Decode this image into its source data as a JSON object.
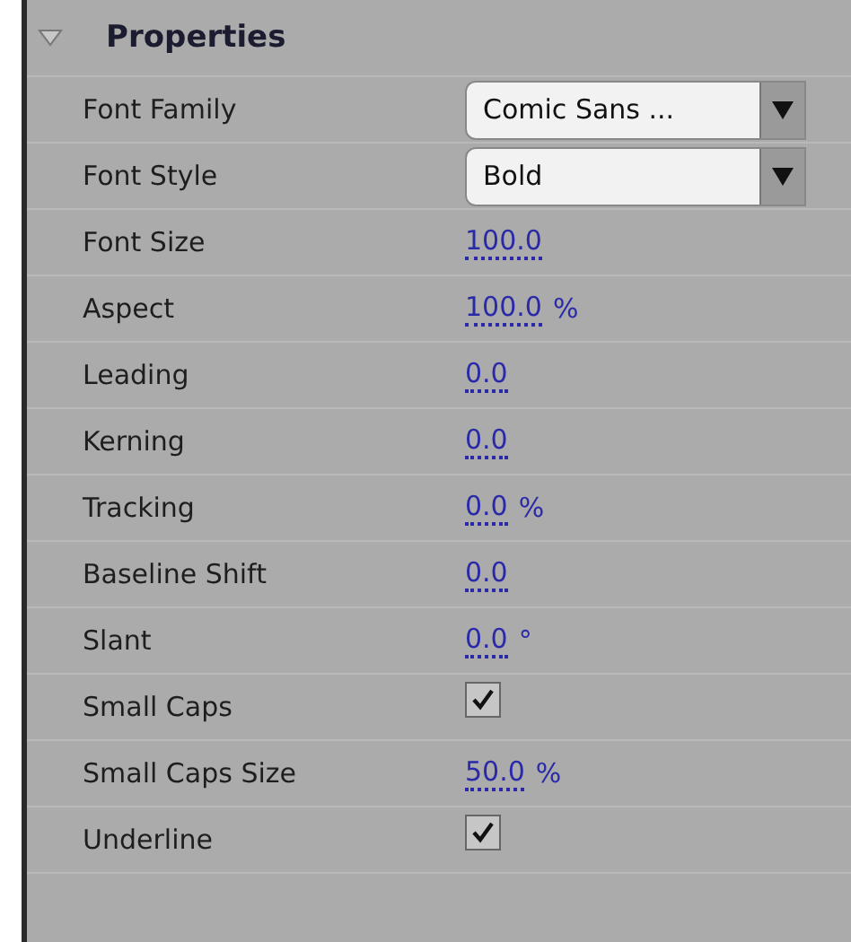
{
  "panel": {
    "title": "Properties",
    "expanded": true
  },
  "properties": [
    {
      "kind": "dropdown",
      "label": "Font Family",
      "value": "Comic Sans ..."
    },
    {
      "kind": "dropdown",
      "label": "Font Style",
      "value": "Bold"
    },
    {
      "kind": "number",
      "label": "Font Size",
      "value": "100.0"
    },
    {
      "kind": "number",
      "label": "Aspect",
      "value": "100.0",
      "unit": "%"
    },
    {
      "kind": "number",
      "label": "Leading",
      "value": "0.0"
    },
    {
      "kind": "number",
      "label": "Kerning",
      "value": "0.0"
    },
    {
      "kind": "number",
      "label": "Tracking",
      "value": "0.0",
      "unit": "%"
    },
    {
      "kind": "number",
      "label": "Baseline Shift",
      "value": "0.0"
    },
    {
      "kind": "number",
      "label": "Slant",
      "value": "0.0",
      "unit": "°"
    },
    {
      "kind": "checkbox",
      "label": "Small Caps",
      "checked": true
    },
    {
      "kind": "number",
      "label": "Small Caps Size",
      "value": "50.0",
      "unit": "%"
    },
    {
      "kind": "checkbox",
      "label": "Underline",
      "checked": true
    }
  ]
}
